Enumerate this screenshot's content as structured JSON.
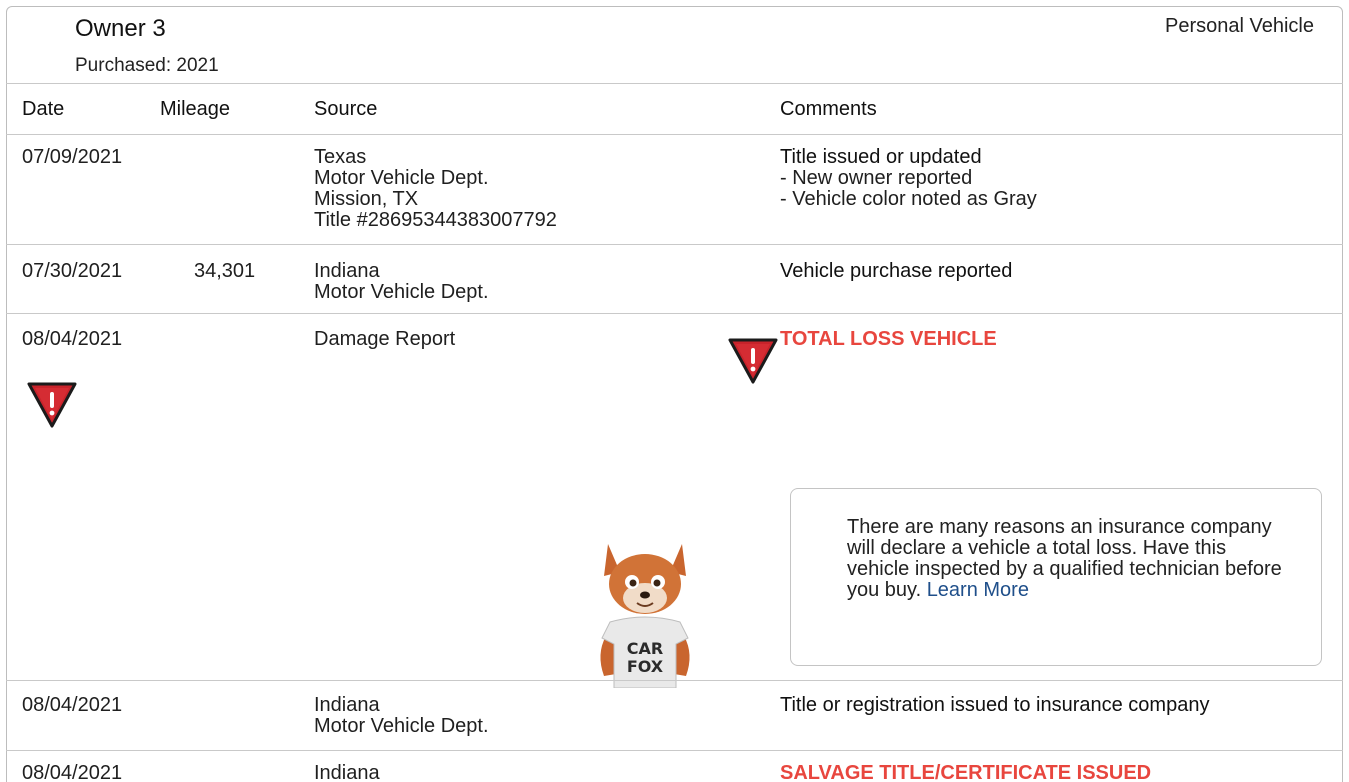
{
  "owner": {
    "title": "Owner 3",
    "purchased": "Purchased: 2021",
    "vehicle_type": "Personal Vehicle"
  },
  "table": {
    "headers": {
      "date": "Date",
      "mileage": "Mileage",
      "source": "Source",
      "comments": "Comments"
    },
    "rows": [
      {
        "date": "07/09/2021",
        "mileage": "",
        "source": [
          "Texas",
          "Motor Vehicle Dept.",
          "Mission, TX",
          "Title #28695344383007792"
        ],
        "comment_title": "Title issued or updated",
        "comment_lines": [
          "- New owner reported",
          "- Vehicle color noted as Gray"
        ]
      },
      {
        "date": "07/30/2021",
        "mileage": "34,301",
        "source": [
          "Indiana",
          "Motor Vehicle Dept."
        ],
        "comment_title": "Vehicle purchase reported"
      },
      {
        "date": "08/04/2021",
        "mileage": "",
        "source": [
          "Damage Report"
        ],
        "comment_title": "TOTAL LOSS VEHICLE"
      },
      {
        "date": "08/04/2021",
        "mileage": "",
        "source": [
          "Indiana",
          "Motor Vehicle Dept."
        ],
        "comment_title": "Title or registration issued to insurance company"
      },
      {
        "date": "08/04/2021",
        "mileage": "",
        "source": [
          "Indiana"
        ],
        "comment_title": "SALVAGE TITLE/CERTIFICATE ISSUED"
      }
    ]
  },
  "info_box": {
    "text": "There are many reasons an insurance company will declare a vehicle a total loss. Have this vehicle inspected by a qualified technician before you buy.",
    "link": "Learn More"
  },
  "mascot": {
    "shirt_line1": "CAR",
    "shirt_line2": "FOX"
  },
  "colors": {
    "alert": "#e8463e",
    "icon_red": "#c8232b",
    "link": "#1f4f8a"
  },
  "icons": {
    "warning": "warning-triangle-icon"
  }
}
